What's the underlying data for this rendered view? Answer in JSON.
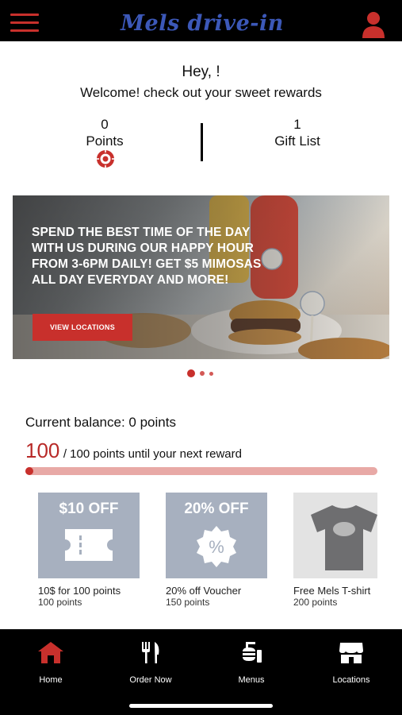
{
  "header": {
    "logo_text": "Mels drive-in",
    "brand_color": "#c8302c",
    "logo_color": "#3c58b8"
  },
  "greeting": "Hey, !",
  "welcome": "Welcome! check out your sweet rewards",
  "stats": {
    "points_value": "0",
    "points_label": "Points",
    "gifts_value": "1",
    "gifts_label": "Gift List"
  },
  "banner": {
    "text": "Spend the best time of the day with us during our happy hour from 3-6pm daily! Get $5 mimosas all day everyday and more!",
    "button_label": "VIEW LOCATIONS",
    "carousel_pages": 3,
    "active_page": 1
  },
  "balance": {
    "text": "Current balance: 0 points",
    "remaining": "100",
    "remaining_suffix": "/ 100 points until your next reward",
    "progress_fraction": 0.0
  },
  "rewards": [
    {
      "badge": "$10 OFF",
      "icon": "ticket-icon",
      "name": "10$ for 100 points",
      "points": "100 points"
    },
    {
      "badge": "20% OFF",
      "icon": "percent-badge-icon",
      "name": "20% off Voucher",
      "points": "150 points"
    },
    {
      "badge": "",
      "icon": "tshirt-icon",
      "name": "Free Mels T-shirt",
      "points": "200 points"
    }
  ],
  "nav": [
    {
      "label": "Home",
      "icon": "home-icon",
      "active": true
    },
    {
      "label": "Order Now",
      "icon": "fork-knife-icon",
      "active": false
    },
    {
      "label": "Menus",
      "icon": "menu-food-icon",
      "active": false
    },
    {
      "label": "Locations",
      "icon": "store-icon",
      "active": false
    }
  ]
}
